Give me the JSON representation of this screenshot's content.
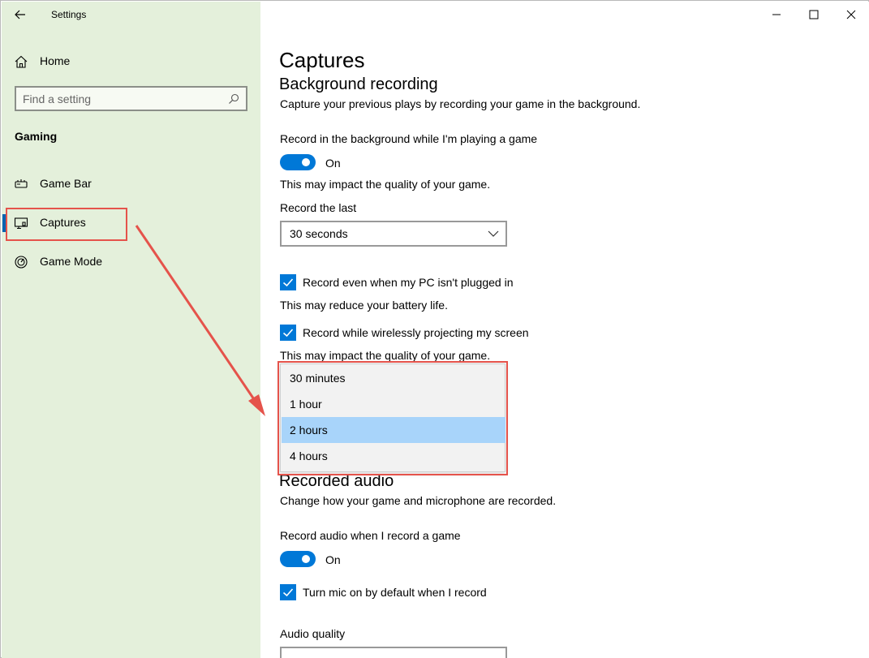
{
  "window": {
    "app_title": "Settings"
  },
  "sidebar": {
    "home_label": "Home",
    "search_placeholder": "Find a setting",
    "section_heading": "Gaming",
    "items": [
      {
        "label": "Game Bar",
        "icon": "game-bar-icon",
        "active": false
      },
      {
        "label": "Captures",
        "icon": "captures-icon",
        "active": true
      },
      {
        "label": "Game Mode",
        "icon": "game-mode-icon",
        "active": false
      }
    ]
  },
  "main": {
    "page_title": "Captures",
    "background": {
      "heading": "Background recording",
      "description": "Capture your previous plays by recording your game in the background.",
      "record_bg_label": "Record in the background while I'm playing a game",
      "record_bg_toggle": "On",
      "impact_note": "This may impact the quality of your game.",
      "record_last_label": "Record the last",
      "record_last_value": "30 seconds",
      "plugged_in_label": "Record even when my PC isn't plugged in",
      "battery_note": "This may reduce your battery life.",
      "projecting_label": "Record while wirelessly projecting my screen",
      "projecting_note": "This may impact the quality of your game."
    },
    "dropdown_options": [
      "30 minutes",
      "1 hour",
      "2 hours",
      "4 hours"
    ],
    "dropdown_selected": "2 hours",
    "audio": {
      "heading": "Recorded audio",
      "description": "Change how your game and microphone are recorded.",
      "record_audio_label": "Record audio when I record a game",
      "record_audio_toggle": "On",
      "mic_label": "Turn mic on by default when I record",
      "quality_label": "Audio quality"
    }
  },
  "colors": {
    "sidebar_bg": "#e4f0db",
    "accent": "#0078d7",
    "selected_option": "#a8d4fa",
    "annotation_red": "#e5534b"
  }
}
